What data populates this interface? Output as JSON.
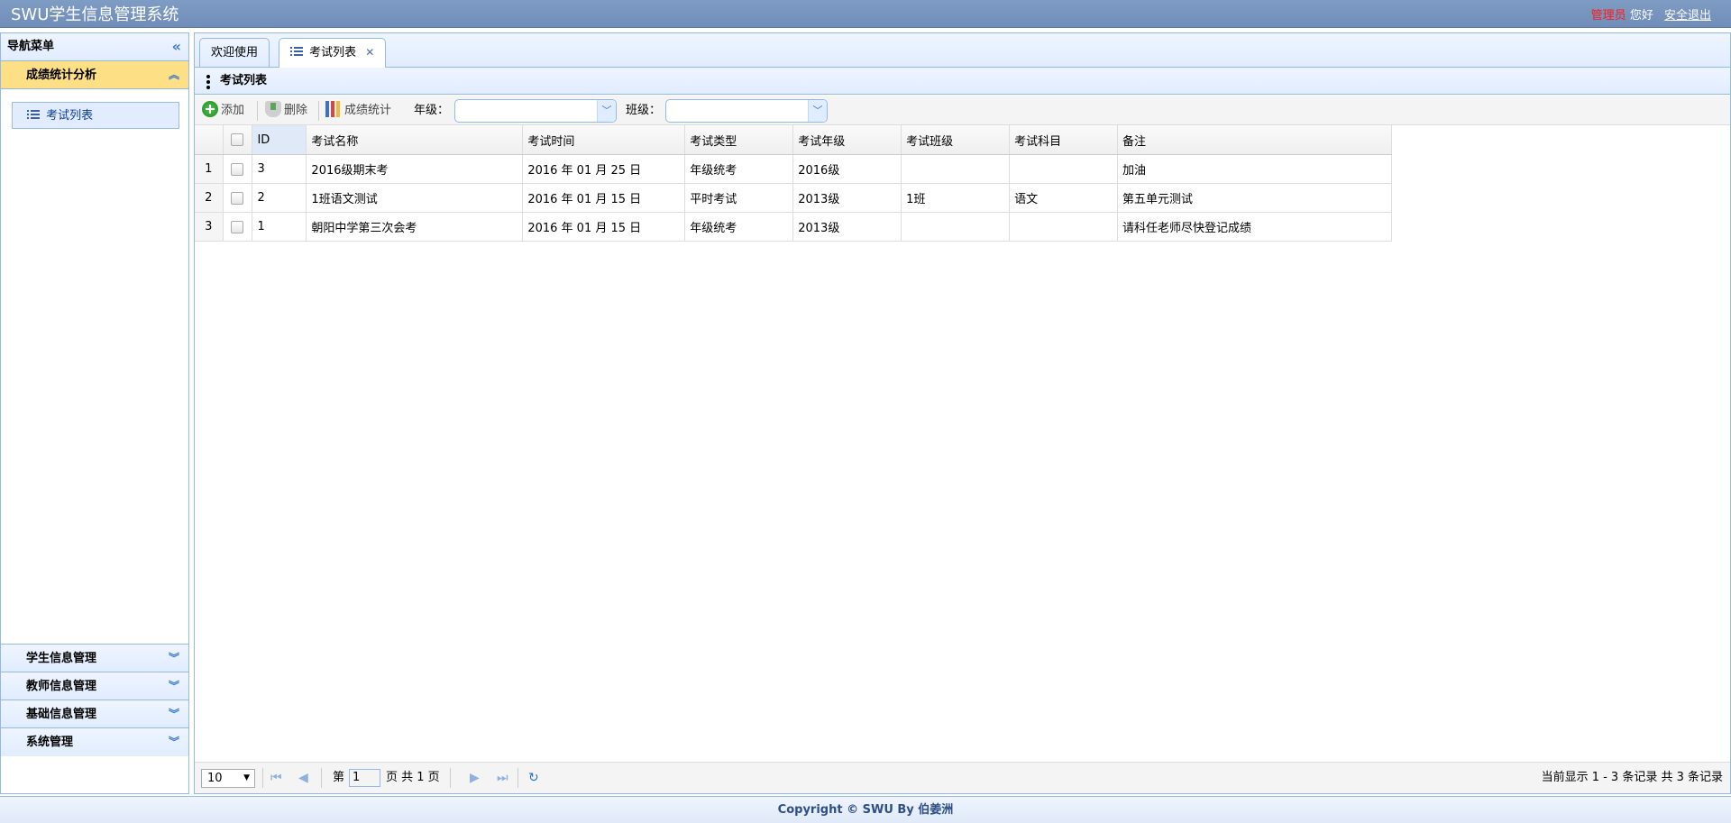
{
  "header": {
    "title": "SWU学生信息管理系统",
    "role": "管理员",
    "greeting": "您好",
    "logout": "安全退出"
  },
  "sidebar": {
    "title": "导航菜单",
    "collapse_icon": "double-chevron-left-icon",
    "active_group": {
      "label": "成绩统计分析",
      "items": [
        {
          "label": "考试列表",
          "icon": "list-icon"
        }
      ]
    },
    "groups": [
      {
        "label": "学生信息管理"
      },
      {
        "label": "教师信息管理"
      },
      {
        "label": "基础信息管理"
      },
      {
        "label": "系统管理"
      }
    ]
  },
  "tabs": [
    {
      "label": "欢迎使用",
      "active": false
    },
    {
      "label": "考试列表",
      "active": true,
      "closable": true
    }
  ],
  "panel": {
    "title": "考试列表"
  },
  "toolbar": {
    "add_label": "添加",
    "delete_label": "删除",
    "stats_label": "成绩统计",
    "grade_label": "年级：",
    "grade_value": "",
    "class_label": "班级：",
    "class_value": ""
  },
  "grid": {
    "columns": [
      "ID",
      "考试名称",
      "考试时间",
      "考试类型",
      "考试年级",
      "考试班级",
      "考试科目",
      "备注"
    ],
    "rows": [
      {
        "rownum": "1",
        "cells": [
          "3",
          "2016级期末考",
          "2016 年 01 月 25 日",
          "年级统考",
          "2016级",
          "",
          "",
          "加油"
        ]
      },
      {
        "rownum": "2",
        "cells": [
          "2",
          "1班语文测试",
          "2016 年 01 月 15 日",
          "平时考试",
          "2013级",
          "1班",
          "语文",
          "第五单元测试"
        ]
      },
      {
        "rownum": "3",
        "cells": [
          "1",
          "朝阳中学第三次会考",
          "2016 年 01 月 15 日",
          "年级统考",
          "2013级",
          "",
          "",
          "请科任老师尽快登记成绩"
        ]
      }
    ]
  },
  "pager": {
    "page_size": "10",
    "before_page": "第",
    "page": "1",
    "page_total_text": "页 共 1 页",
    "info": "当前显示 1 - 3 条记录 共 3 条记录"
  },
  "footer": {
    "copyright": "Copyright © SWU By 伯姜洲"
  }
}
